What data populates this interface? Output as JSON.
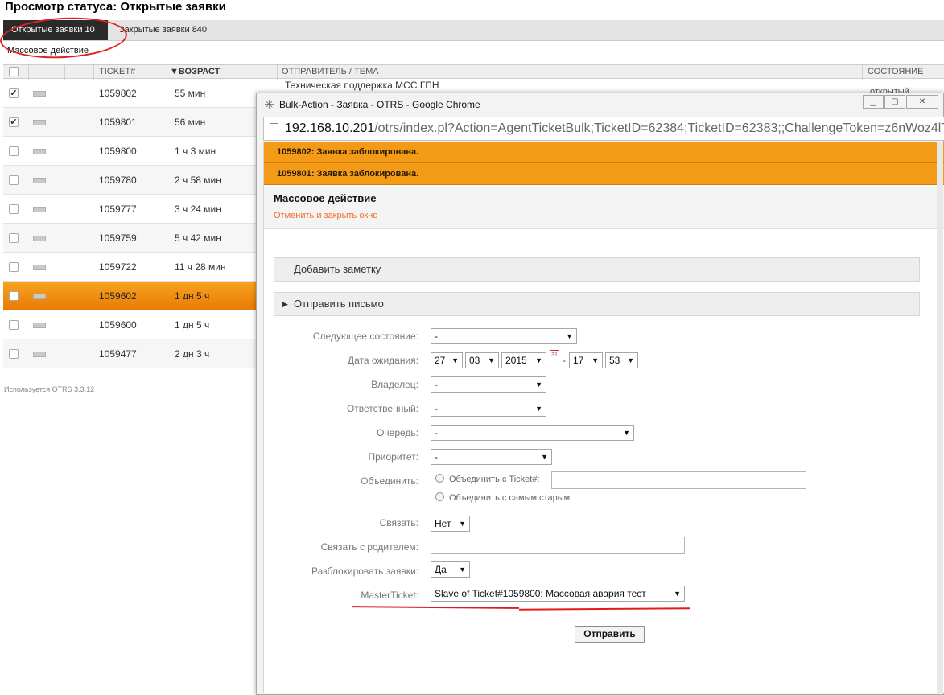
{
  "page": {
    "title": "Просмотр статуса: Открытые заявки",
    "tabs": [
      {
        "label": "Открытые заявки 10"
      },
      {
        "label": "Закрытые заявки 840"
      }
    ],
    "bulk_action": "Массовое действие",
    "footer": "Используется OTRS 3.3.12"
  },
  "table": {
    "headers": {
      "ticket": "TICKET#",
      "age": "▼ВОЗРАСТ",
      "sender": "ОТПРАВИТЕЛЬ / ТЕМА",
      "state": "СОСТОЯНИЕ"
    },
    "first_row_subject": "Техническая поддержка МСС ГПН",
    "first_row_state": "открытый",
    "rows": [
      {
        "ticket": "1059802",
        "age": "55 мин",
        "checked": "✔"
      },
      {
        "ticket": "1059801",
        "age": "56 мин",
        "checked": "✔"
      },
      {
        "ticket": "1059800",
        "age": "1 ч 3 мин",
        "checked": ""
      },
      {
        "ticket": "1059780",
        "age": "2 ч 58 мин",
        "checked": ""
      },
      {
        "ticket": "1059777",
        "age": "3 ч 24 мин",
        "checked": ""
      },
      {
        "ticket": "1059759",
        "age": "5 ч 42 мин",
        "checked": ""
      },
      {
        "ticket": "1059722",
        "age": "11 ч 28 мин",
        "checked": ""
      },
      {
        "ticket": "1059602",
        "age": "1 дн 5 ч",
        "checked": ""
      },
      {
        "ticket": "1059600",
        "age": "1 дн 5 ч",
        "checked": ""
      },
      {
        "ticket": "1059477",
        "age": "2 дн 3 ч",
        "checked": ""
      }
    ]
  },
  "popup": {
    "window_title": "Bulk-Action - Заявка - OTRS - Google Chrome",
    "url_host": "192.168.10.201",
    "url_rest": "/otrs/index.pl?Action=AgentTicketBulk;TicketID=62384;TicketID=62383;;ChallengeToken=z6nWoz4lT",
    "notices": [
      "1059802: Заявка заблокирована.",
      "1059801: Заявка заблокирована."
    ],
    "dialog_title": "Массовое действие",
    "cancel_link": "Отменить и закрыть окно",
    "section_note": "Добавить заметку",
    "section_email": "Отправить письмо",
    "labels": {
      "next_state": "Следующее состояние:",
      "pending_date": "Дата ожидания:",
      "owner": "Владелец:",
      "responsible": "Ответственный:",
      "queue": "Очередь:",
      "priority": "Приоритет:",
      "merge": "Объединить:",
      "link": "Связать:",
      "link_parent": "Связать с родителем:",
      "unlock": "Разблокировать заявки:",
      "master": "MasterTicket:"
    },
    "values": {
      "next_state": "-",
      "day": "27",
      "month": "03",
      "year": "2015",
      "date_sep": "-",
      "hour": "17",
      "minute": "53",
      "owner": "-",
      "responsible": "-",
      "queue": "-",
      "priority": "-",
      "merge_with_ticket": "Объединить с Ticket#:",
      "merge_oldest": "Объединить с самым старым",
      "link": "Нет",
      "unlock": "Да",
      "master": "Slave of Ticket#1059800: Массовая авария тест"
    },
    "submit": "Отправить"
  },
  "colors": {
    "accent_orange": "#f39b17",
    "highlight_row": "#e97c04",
    "annotation_red": "#e21b1b",
    "cancel_link": "#f26d1f"
  }
}
